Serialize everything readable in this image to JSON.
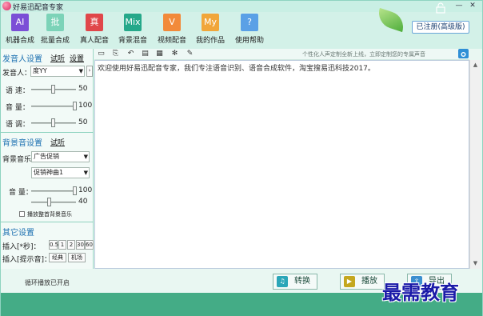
{
  "window": {
    "title": "好易迅配音专家",
    "minimize_glyph": "—",
    "close_glyph": "✕"
  },
  "toolbar": {
    "items": [
      {
        "label": "机器合成",
        "icon_text": "AI",
        "color": "#7b4fd6"
      },
      {
        "label": "批量合成",
        "icon_text": "批",
        "color": "#7cd3b8"
      },
      {
        "label": "真人配音",
        "icon_text": "真",
        "color": "#e0474a"
      },
      {
        "label": "背景混音",
        "icon_text": "Mix",
        "color": "#25a88a"
      },
      {
        "label": "视频配音",
        "icon_text": "V",
        "color": "#f28a3a"
      },
      {
        "label": "我的作品",
        "icon_text": "My",
        "color": "#f1a63a"
      },
      {
        "label": "使用帮助",
        "icon_text": "?",
        "color": "#5aa0e6"
      }
    ],
    "register_button": "已注册(高级版)"
  },
  "voice_settings": {
    "title": "发音人设置",
    "trial_link": "试听",
    "settings_link": "设置",
    "voice_label": "发音人：",
    "voice_value": "度YY",
    "speed_label": "语  速：",
    "speed_value": "50",
    "volume_label": "音  量：",
    "volume_value": "100",
    "pitch_label": "语  调：",
    "pitch_value": "50"
  },
  "bg_settings": {
    "title": "背景音设置",
    "trial_link": "试听",
    "music_label": "背景音乐",
    "category_value": "广告促销",
    "track_value": "促销神曲1",
    "volume_label": "音  量：",
    "volume_value": "100",
    "level_value": "40",
    "loop_label": "播放整首背景音乐"
  },
  "other_settings": {
    "title": "其它设置",
    "insert_seconds_label": "插入[*秒]：",
    "seconds_options": [
      "0.5",
      "1",
      "2",
      "30",
      "60"
    ],
    "insert_sound_label": "插入[提示音]：",
    "sound_options": [
      "经典",
      "机场"
    ]
  },
  "editor": {
    "hint": "个性化人声定制全新上线，立即定制您的专属声音",
    "content": "欢迎使用好易迅配音专家，我们专注语音识别、语音合成软件，淘宝搜易迅科技2017。",
    "tool_icons": [
      "▭",
      "⎘",
      "↶",
      "▤",
      "▦",
      "✻",
      "✎"
    ]
  },
  "bottom": {
    "status": "循环播放已开启",
    "convert_button": "转换",
    "play_button": "播放",
    "export_button": "导出"
  },
  "watermark": "最需教育",
  "colors": {
    "accent": "#1a6fb0",
    "footer": "#44ac86",
    "window_bg": "#e9f7f2"
  }
}
